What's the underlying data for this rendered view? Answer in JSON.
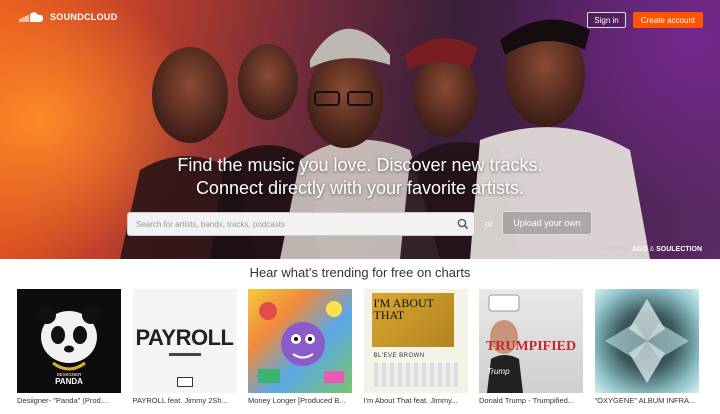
{
  "header": {
    "logo_text": "SOUNDCLOUD",
    "signin_label": "Sign in",
    "create_label": "Create account"
  },
  "hero": {
    "headline_1": "Find the music you love. Discover new tracks.",
    "headline_2": "Connect directly with your favorite artists.",
    "search_placeholder": "Search for artists, bands, tracks, podcasts",
    "or_label": "or",
    "upload_label": "Upload your own",
    "featured_prefix": "Featured:",
    "featured_artist_1": "AGD",
    "featured_and": "&",
    "featured_artist_2": "SOULECTION"
  },
  "trending": {
    "title": "Hear what’s trending for free on charts",
    "tracks": [
      {
        "title": "Desiigner- \"Panda\" (Prod....",
        "art_text": "PANDA",
        "art_small": "DESIIGNER"
      },
      {
        "title": "PAYROLL feat. Jimmy 2Sh...",
        "art_text": "PAYROLL",
        "art_small": ""
      },
      {
        "title": "Money Longer [Produced B...",
        "art_text": "",
        "art_small": ""
      },
      {
        "title": "I'm About That feat. Jimmy...",
        "art_text": "I'M ABOUT THAT",
        "art_small": "BL'EVE BROWN"
      },
      {
        "title": "Donald Trump - Trumpified...",
        "art_text": "TRUMPIFIED",
        "art_small": "Trump"
      },
      {
        "title": "\"OXYGENE\" ALBUM INFRA...",
        "art_text": "",
        "art_small": ""
      }
    ]
  },
  "colors": {
    "accent": "#ff5500"
  }
}
